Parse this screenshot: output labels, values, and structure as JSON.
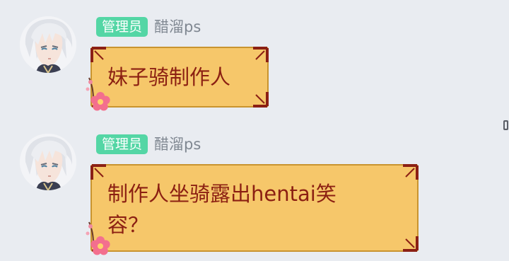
{
  "messages": [
    {
      "role_badge": "管理员",
      "nickname": "醋溜ps",
      "avatar_icon": "white-haired-anime-boy-avatar",
      "text_lines": [
        "妹子骑制作人"
      ]
    },
    {
      "role_badge": "管理员",
      "nickname": "醋溜ps",
      "avatar_icon": "white-haired-anime-boy-avatar",
      "text_lines": [
        "制作人坐骑露出hentai笑",
        "容？"
      ]
    }
  ],
  "colors": {
    "background": "#e9ecf1",
    "badge": "#54d6a5",
    "bubble_fill": "#f6c76a",
    "bubble_text": "#8b1f12",
    "bubble_border": "#8b2014"
  },
  "decor_icons": [
    "plum-blossom-icon",
    "corner-ornament-icon"
  ]
}
